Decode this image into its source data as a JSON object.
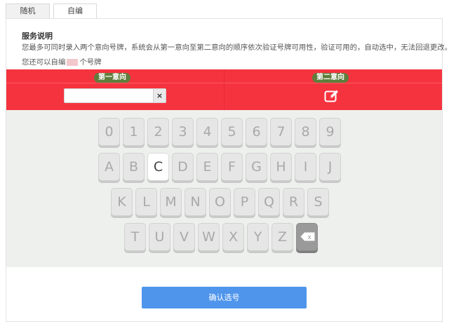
{
  "tabs": [
    {
      "label": "随机"
    },
    {
      "label": "自编"
    }
  ],
  "info": {
    "title": "服务说明",
    "text": "您最多可同时录入两个意向号牌，系统会从第一意向至第二意向的顺序依次验证号牌可用性，验证可用的，自动选中，无法回退更改。",
    "remain_prefix": "您还可以自编",
    "remain_suffix": "个号牌"
  },
  "choices": {
    "first_label": "第一意向",
    "second_label": "第二意向",
    "first_value": "",
    "clear_symbol": "×"
  },
  "keyboard": {
    "row1": [
      "0",
      "1",
      "2",
      "3",
      "4",
      "5",
      "6",
      "7",
      "8",
      "9"
    ],
    "row2": [
      "A",
      "B",
      "C",
      "D",
      "E",
      "F",
      "G",
      "H",
      "I",
      "J"
    ],
    "row3": [
      "K",
      "L",
      "M",
      "N",
      "O",
      "P",
      "Q",
      "R",
      "S"
    ],
    "row4": [
      "T",
      "U",
      "V",
      "W",
      "X",
      "Y",
      "Z"
    ],
    "highlighted_key": "C",
    "delete_label": "x"
  },
  "confirm": {
    "label": "确认选号"
  },
  "colors": {
    "accent_red": "#f5333f",
    "label_green": "#5f7d3b",
    "button_blue": "#4f95ec"
  },
  "icons": {
    "edit": "edit-icon",
    "clear": "clear-icon",
    "delete": "backspace-icon"
  }
}
